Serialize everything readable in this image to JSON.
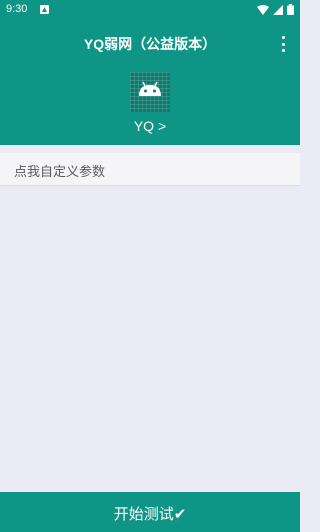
{
  "status_bar": {
    "time": "9:30"
  },
  "app_bar": {
    "title": "YQ弱网（公益版本）",
    "subtitle": "YQ >"
  },
  "custom_params": {
    "placeholder": "点我自定义参数"
  },
  "bottom_button": {
    "label": "开始测试✔"
  },
  "colors": {
    "primary": "#0f9586",
    "background": "#ebebf5"
  },
  "icons": {
    "status": [
      "app-icon",
      "wifi-icon",
      "signal-icon",
      "battery-icon"
    ],
    "menu": "more-vert-icon",
    "logo": "android-icon"
  }
}
